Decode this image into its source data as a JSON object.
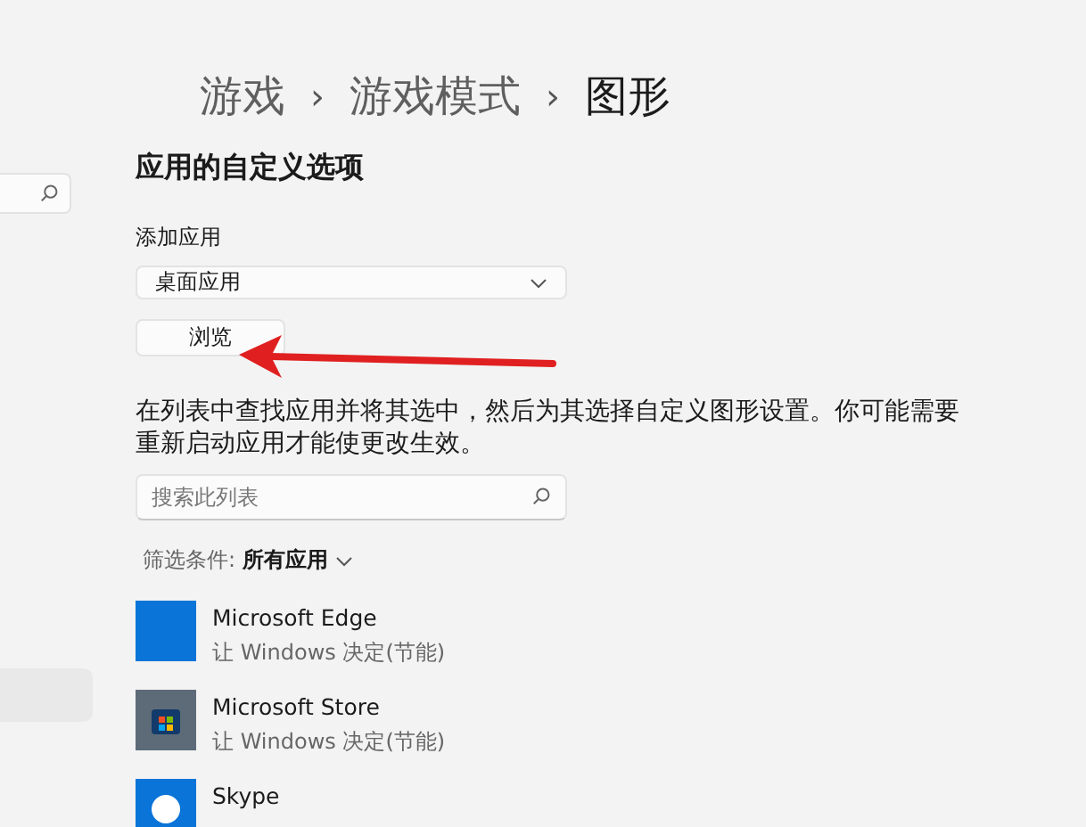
{
  "breadcrumb": [
    "游戏",
    "游戏模式",
    "图形"
  ],
  "separator": "›",
  "section_title": "应用的自定义选项",
  "add_app": {
    "label": "添加应用",
    "dropdown_value": "桌面应用",
    "browse_button": "浏览"
  },
  "description": "在列表中查找应用并将其选中，然后为其选择自定义图形设置。你可能需要重新启动应用才能使更改生效。",
  "search": {
    "placeholder": "搜索此列表"
  },
  "filter": {
    "label": "筛选条件:",
    "value": "所有应用"
  },
  "apps": [
    {
      "kind": "edge",
      "name": "Microsoft Edge",
      "setting": "让 Windows 决定(节能)"
    },
    {
      "kind": "store",
      "name": "Microsoft Store",
      "setting": "让 Windows 决定(节能)"
    },
    {
      "kind": "skype",
      "name": "Skype"
    }
  ]
}
